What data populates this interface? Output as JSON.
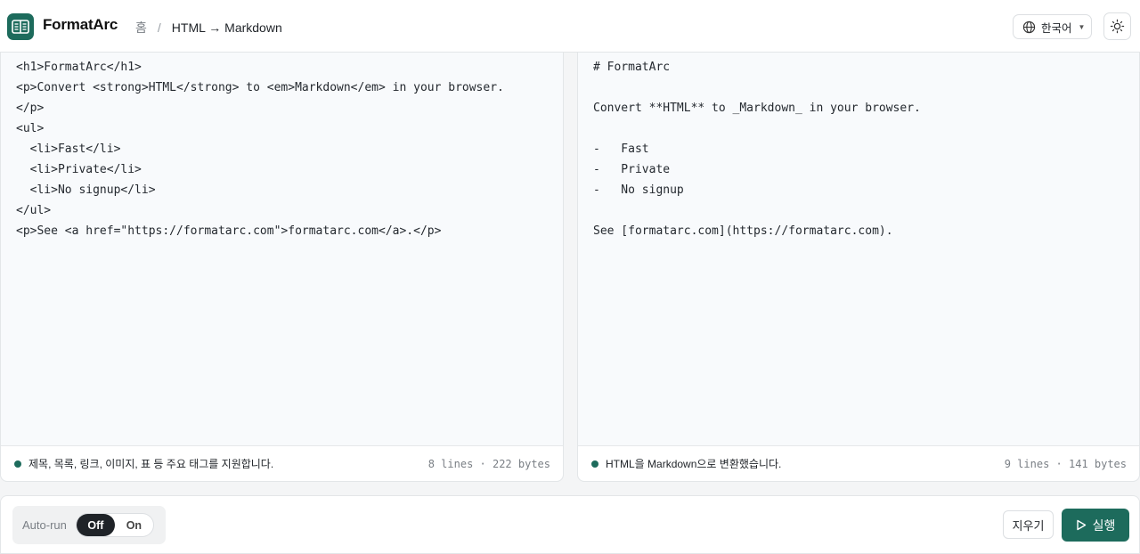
{
  "header": {
    "brand": "FormatArc",
    "breadcrumb": {
      "home": "홈",
      "separator": "/",
      "current": "HTML → Markdown"
    },
    "language": {
      "label": "한국어",
      "icon": "globe-icon"
    },
    "theme_icon": "sun-icon"
  },
  "input_panel": {
    "code": "<h1>FormatArc</h1>\n<p>Convert <strong>HTML</strong> to <em>Markdown</em> in your browser.\n</p>\n<ul>\n  <li>Fast</li>\n  <li>Private</li>\n  <li>No signup</li>\n</ul>\n<p>See <a href=\"https://formatarc.com\">formatarc.com</a>.</p>",
    "status": "제목, 목록, 링크, 이미지, 표 등 주요 태그를 지원합니다.",
    "stats": "8 lines · 222 bytes"
  },
  "output_panel": {
    "code": "# FormatArc\n\nConvert **HTML** to _Markdown_ in your browser.\n\n-   Fast\n-   Private\n-   No signup\n\nSee [formatarc.com](https://formatarc.com).",
    "status": "HTML을 Markdown으로 변환했습니다.",
    "stats": "9 lines · 141 bytes"
  },
  "bottom": {
    "autorun_label": "Auto-run",
    "toggle_off": "Off",
    "toggle_on": "On",
    "toggle_selected": "Off",
    "clear_label": "지우기",
    "run_label": "실행"
  },
  "colors": {
    "accent": "#1d6b5c",
    "background": "#f4f5f6",
    "panel": "#f8fafc",
    "dark": "#1f2328"
  }
}
